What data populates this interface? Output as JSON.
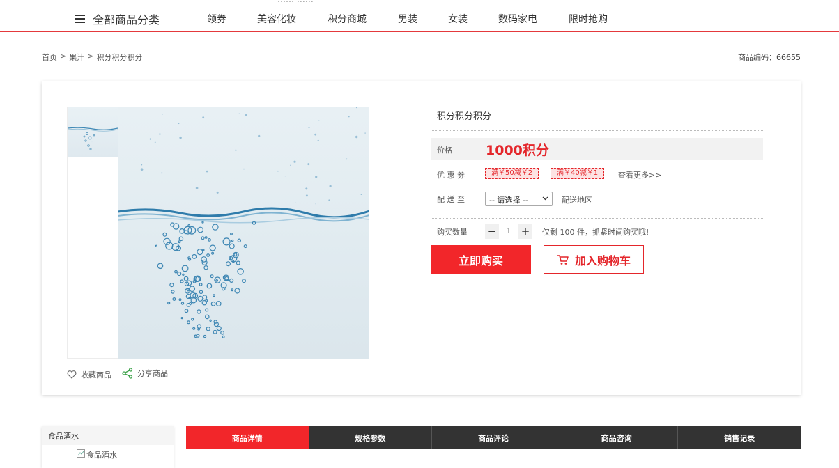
{
  "topnav": {
    "ghost_text": "…… ……",
    "category_label": "全部商品分类",
    "items": [
      "领券",
      "美容化妆",
      "积分商城",
      "男装",
      "女装",
      "数码家电",
      "限时抢购"
    ]
  },
  "breadcrumb": {
    "items": [
      "首页",
      "果汁",
      "积分积分积分"
    ],
    "separator": ">"
  },
  "product_code": "商品编码：66655",
  "product": {
    "title": "积分积分积分",
    "price_label": "价格",
    "price": "1000积分",
    "coupon_label": "优 惠 券",
    "coupons": [
      "满￥50减￥2",
      "满￥40减￥1"
    ],
    "coupon_more": "查看更多>>",
    "ship_label": "配 送 至",
    "ship_select": "-- 请选择 --",
    "ship_region": "配送地区",
    "qty_label": "购买数量",
    "qty_value": "1",
    "qty_minus": "−",
    "qty_plus": "+",
    "stock_text": "仅剩 100 件，抓紧时间购买哦!",
    "buy_label": "立即购买",
    "cart_label": "加入购物车",
    "favorite_label": "收藏商品",
    "share_label": "分享商品"
  },
  "sidebar": {
    "title": "食品酒水",
    "image_alt": "食品酒水"
  },
  "tabs": [
    "商品详情",
    "规格参数",
    "商品评论",
    "商品咨询",
    "销售记录"
  ],
  "colors": {
    "accent": "#f2262a",
    "tab_dark": "#333333"
  }
}
